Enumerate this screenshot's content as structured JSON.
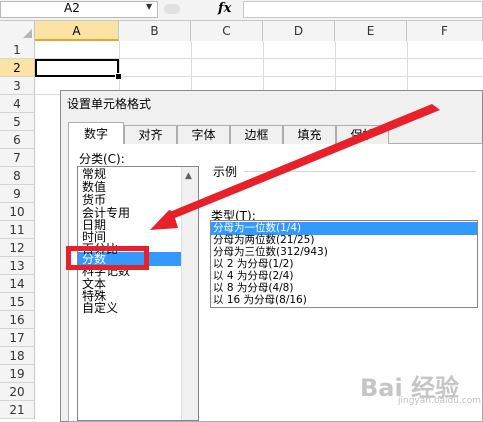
{
  "formula_bar": {
    "name_box": "A2",
    "fx_label": "fx",
    "formula_value": ""
  },
  "sheet": {
    "columns": [
      "A",
      "B",
      "C",
      "D",
      "E",
      "F"
    ],
    "active_column": "A",
    "rows": [
      "1",
      "2",
      "3",
      "4",
      "5",
      "6",
      "7",
      "8",
      "9",
      "10",
      "11",
      "12",
      "13",
      "14",
      "15",
      "16",
      "17",
      "18",
      "19",
      "20",
      "21",
      "22"
    ],
    "active_row": "2",
    "selected_cell": "A2"
  },
  "dialog": {
    "title": "设置单元格格式",
    "tabs": [
      {
        "label": "数字",
        "active": true
      },
      {
        "label": "对齐",
        "active": false
      },
      {
        "label": "字体",
        "active": false
      },
      {
        "label": "边框",
        "active": false
      },
      {
        "label": "填充",
        "active": false
      },
      {
        "label": "保护",
        "active": false
      }
    ],
    "category_label": "分类(C):",
    "categories": [
      "常规",
      "数值",
      "货币",
      "会计专用",
      "日期",
      "时间",
      "百分比",
      "分数",
      "科学记数",
      "文本",
      "特殊",
      "自定义"
    ],
    "selected_category": "分数",
    "sample_label": "示例",
    "type_label": "类型(T):",
    "types": [
      "分母为一位数(1/4)",
      "分母为两位数(21/25)",
      "分母为三位数(312/943)",
      "以 2 为分母(1/2)",
      "以 4 为分母(2/4)",
      "以 8 为分母(4/8)",
      "以 16 为分母(8/16)"
    ],
    "selected_type": "分母为一位数(1/4)"
  },
  "annotation": {
    "highlight_color": "#e8202a",
    "arrow_color": "#e8202a"
  },
  "watermark": {
    "text": "Bai 经验",
    "sub": "jingyan.baidu.com"
  },
  "colors": {
    "selection_blue": "#3399ff",
    "header_active": "#fbe3a3",
    "dialog_bg": "#f0f0f0"
  }
}
